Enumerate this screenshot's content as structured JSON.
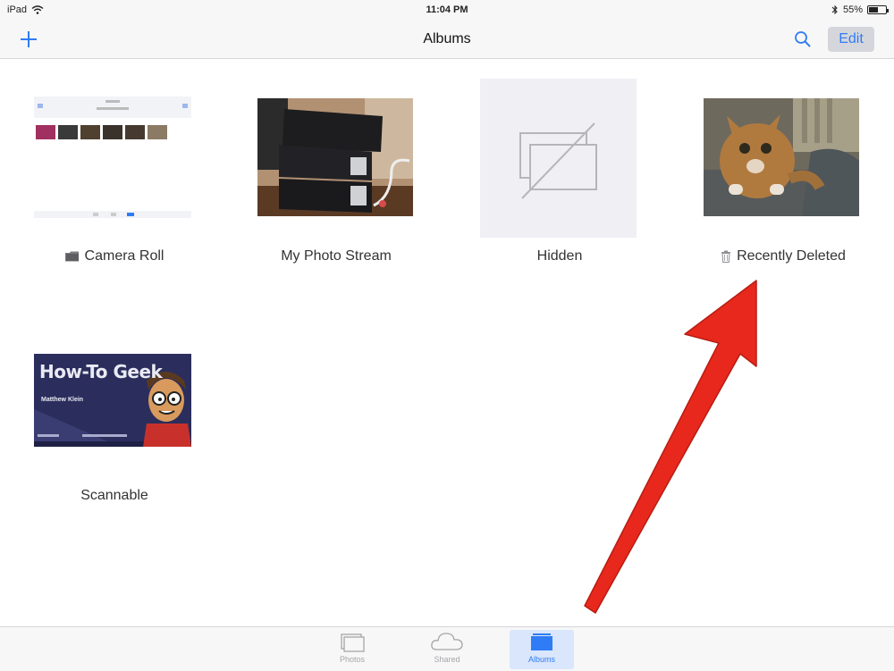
{
  "status": {
    "device": "iPad",
    "time": "11:04 PM",
    "battery": "55%",
    "battery_level": 0.55
  },
  "nav": {
    "title": "Albums",
    "edit_label": "Edit"
  },
  "albums": [
    {
      "name": "Camera Roll",
      "icon": "folder-icon"
    },
    {
      "name": "My Photo Stream",
      "icon": ""
    },
    {
      "name": "Hidden",
      "icon": "hidden-placeholder-icon"
    },
    {
      "name": "Recently Deleted",
      "icon": "trash-icon"
    },
    {
      "name": "Scannable",
      "icon": ""
    }
  ],
  "business_card": {
    "title": "How-To Geek",
    "person": "Matthew Klein"
  },
  "tabs": [
    {
      "label": "Photos",
      "icon": "photos-icon",
      "active": false
    },
    {
      "label": "Shared",
      "icon": "cloud-icon",
      "active": false
    },
    {
      "label": "Albums",
      "icon": "albums-icon",
      "active": true
    }
  ],
  "colors": {
    "accent": "#2f7cf6",
    "annotation_arrow": "#e8281c",
    "bar_background": "#f7f7f8"
  }
}
